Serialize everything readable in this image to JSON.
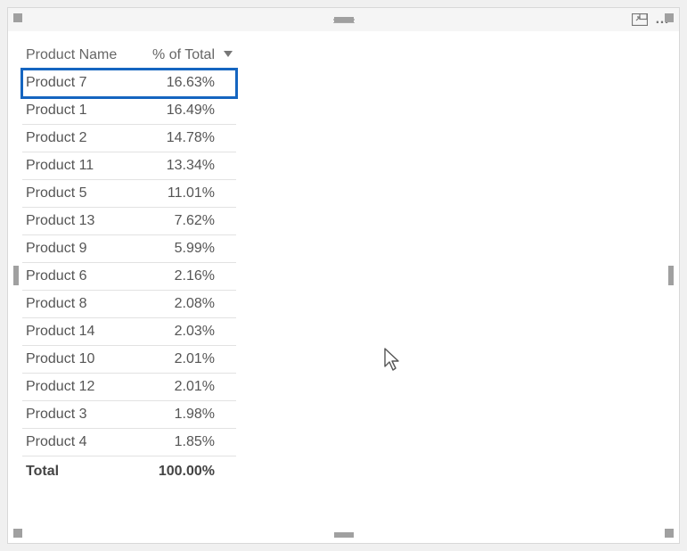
{
  "table": {
    "columns": {
      "name": "Product Name",
      "pct": "% of Total"
    },
    "sort": {
      "column": "pct",
      "direction": "desc"
    },
    "highlighted_row_index": 0,
    "rows": [
      {
        "name": "Product 7",
        "pct": "16.63%"
      },
      {
        "name": "Product 1",
        "pct": "16.49%"
      },
      {
        "name": "Product 2",
        "pct": "14.78%"
      },
      {
        "name": "Product 11",
        "pct": "13.34%"
      },
      {
        "name": "Product 5",
        "pct": "11.01%"
      },
      {
        "name": "Product 13",
        "pct": "7.62%"
      },
      {
        "name": "Product 9",
        "pct": "5.99%"
      },
      {
        "name": "Product 6",
        "pct": "2.16%"
      },
      {
        "name": "Product 8",
        "pct": "2.08%"
      },
      {
        "name": "Product 14",
        "pct": "2.03%"
      },
      {
        "name": "Product 10",
        "pct": "2.01%"
      },
      {
        "name": "Product 12",
        "pct": "2.01%"
      },
      {
        "name": "Product 3",
        "pct": "1.98%"
      },
      {
        "name": "Product 4",
        "pct": "1.85%"
      }
    ],
    "total": {
      "label": "Total",
      "pct": "100.00%"
    }
  },
  "chart_data": {
    "type": "table",
    "title": "",
    "columns": [
      "Product Name",
      "% of Total"
    ],
    "categories": [
      "Product 7",
      "Product 1",
      "Product 2",
      "Product 11",
      "Product 5",
      "Product 13",
      "Product 9",
      "Product 6",
      "Product 8",
      "Product 14",
      "Product 10",
      "Product 12",
      "Product 3",
      "Product 4"
    ],
    "values": [
      16.63,
      16.49,
      14.78,
      13.34,
      11.01,
      7.62,
      5.99,
      2.16,
      2.08,
      2.03,
      2.01,
      2.01,
      1.98,
      1.85
    ],
    "total": 100.0,
    "ylabel": "% of Total"
  }
}
